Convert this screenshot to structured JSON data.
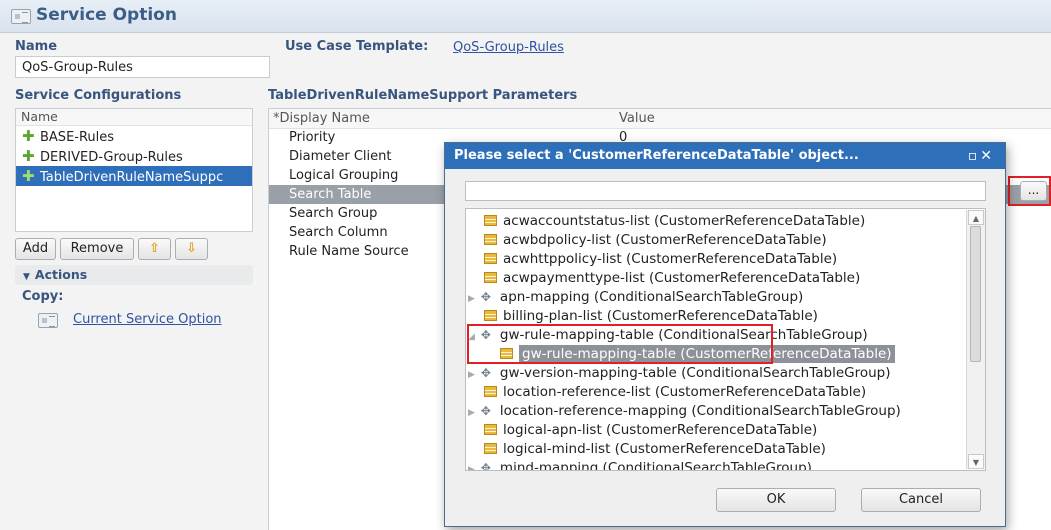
{
  "header": {
    "title": "Service Option"
  },
  "name_section": {
    "label": "Name",
    "value": "QoS-Group-Rules"
  },
  "use_case": {
    "label": "Use Case Template:",
    "link": "QoS-Group-Rules"
  },
  "service_configurations": {
    "label": "Service Configurations",
    "column": "Name",
    "items": [
      "BASE-Rules",
      "DERIVED-Group-Rules",
      "TableDrivenRuleNameSuppc"
    ],
    "selected_index": 2
  },
  "buttons": {
    "add": "Add",
    "remove": "Remove"
  },
  "actions": {
    "label": "Actions",
    "copy_label": "Copy:",
    "current_service_option": "Current Service Option"
  },
  "parameters": {
    "title": "TableDrivenRuleNameSupport Parameters",
    "columns": [
      "*Display Name",
      "Value"
    ],
    "rows": [
      {
        "name": "Priority",
        "value": "0"
      },
      {
        "name": "Diameter Client",
        "value": ""
      },
      {
        "name": "Logical Grouping",
        "value": ""
      },
      {
        "name": "Search Table",
        "value": ""
      },
      {
        "name": "Search Group",
        "value": ""
      },
      {
        "name": "Search Column",
        "value": ""
      },
      {
        "name": "Rule Name Source",
        "value": ""
      }
    ],
    "selected_row": "Search Table",
    "browse_button": "..."
  },
  "dialog": {
    "title": "Please select a 'CustomerReferenceDataTable' object...",
    "search_value": "",
    "tree": [
      {
        "label": "acwaccountstatus-list (CustomerReferenceDataTable)",
        "icon": "table-icon"
      },
      {
        "label": "acwbdpolicy-list (CustomerReferenceDataTable)",
        "icon": "table-icon"
      },
      {
        "label": "acwhttppolicy-list (CustomerReferenceDataTable)",
        "icon": "table-icon"
      },
      {
        "label": "acwpaymenttype-list (CustomerReferenceDataTable)",
        "icon": "table-icon"
      },
      {
        "label": "apn-mapping (ConditionalSearchTableGroup)",
        "icon": "group-icon"
      },
      {
        "label": "billing-plan-list (CustomerReferenceDataTable)",
        "icon": "table-icon"
      },
      {
        "label": "gw-rule-mapping-table (ConditionalSearchTableGroup)",
        "icon": "group-icon"
      },
      {
        "label": "gw-rule-mapping-table (CustomerReferenceDataTable)",
        "icon": "table-icon"
      },
      {
        "label": "gw-version-mapping-table (ConditionalSearchTableGroup)",
        "icon": "group-icon"
      },
      {
        "label": "location-reference-list (CustomerReferenceDataTable)",
        "icon": "table-icon"
      },
      {
        "label": "location-reference-mapping (ConditionalSearchTableGroup)",
        "icon": "group-icon"
      },
      {
        "label": "logical-apn-list (CustomerReferenceDataTable)",
        "icon": "table-icon"
      },
      {
        "label": "logical-mind-list (CustomerReferenceDataTable)",
        "icon": "table-icon"
      },
      {
        "label": "mind-mapping (ConditionalSearchTableGroup)",
        "icon": "group-icon"
      }
    ],
    "ok": "OK",
    "cancel": "Cancel"
  },
  "colors": {
    "accent": "#2e6fba",
    "highlight_box": "#e21f26",
    "selection": "#2f6fb9"
  }
}
